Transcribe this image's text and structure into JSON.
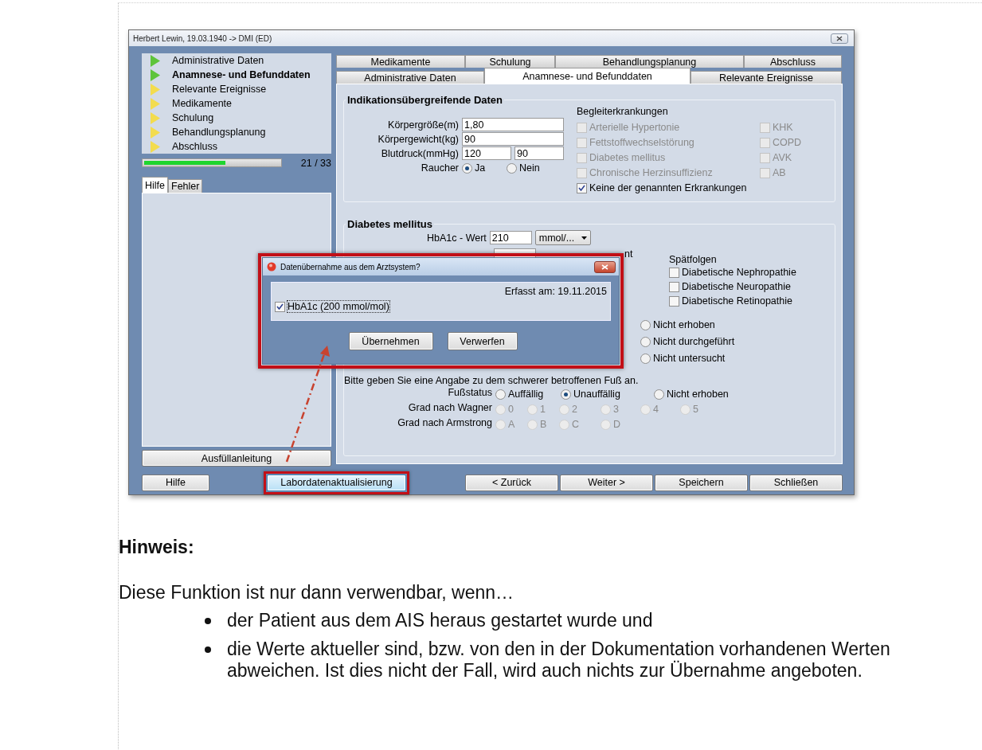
{
  "window": {
    "title": "Herbert Lewin, 19.03.1940 -> DMI (ED)"
  },
  "nav": {
    "items": [
      {
        "label": "Administrative Daten",
        "color": "#5ec43a",
        "selected": false
      },
      {
        "label": "Anamnese- und Befunddaten",
        "color": "#5ec43a",
        "selected": true
      },
      {
        "label": "Relevante Ereignisse",
        "color": "#f3dc4e",
        "selected": false
      },
      {
        "label": "Medikamente",
        "color": "#f3dc4e",
        "selected": false
      },
      {
        "label": "Schulung",
        "color": "#f3dc4e",
        "selected": false
      },
      {
        "label": "Behandlungsplanung",
        "color": "#f3dc4e",
        "selected": false
      },
      {
        "label": "Abschluss",
        "color": "#f3dc4e",
        "selected": false
      }
    ]
  },
  "progress": {
    "level": 0.6,
    "reading": "21 / 33"
  },
  "help_tabs": [
    {
      "label": "Hilfe",
      "selected": true
    },
    {
      "label": "Fehler",
      "selected": false
    }
  ],
  "guide_button": "Ausfüllanleitung",
  "tab_rows": [
    [
      {
        "label": "Medikamente",
        "selected": false
      },
      {
        "label": "Schulung",
        "selected": false
      },
      {
        "label": "Behandlungsplanung",
        "selected": false
      },
      {
        "label": "Abschluss",
        "selected": false
      }
    ],
    [
      {
        "label": "Administrative Daten",
        "selected": false
      },
      {
        "label": "Anamnese- und Befunddaten",
        "selected": true
      },
      {
        "label": "Relevante Ereignisse",
        "selected": false
      }
    ]
  ],
  "general": {
    "title": "Indikationsübergreifende Daten",
    "fields": [
      {
        "label": "Körpergröße(m)",
        "values": [
          "1,80"
        ]
      },
      {
        "label": "Körpergewicht(kg)",
        "values": [
          "90"
        ]
      },
      {
        "label": "Blutdruck(mmHg)",
        "values": [
          "120",
          "90"
        ]
      }
    ],
    "smoker": {
      "label": "Raucher",
      "options": [
        {
          "label": "Ja",
          "selected": true
        },
        {
          "label": "Nein",
          "selected": false
        }
      ]
    },
    "comorbidities": {
      "title": "Begleiterkrankungen",
      "items": [
        {
          "label": "Arterielle Hypertonie",
          "checked": false,
          "disabled": true
        },
        {
          "label": "KHK",
          "checked": false,
          "disabled": true
        },
        {
          "label": "Fettstoffwechselstörung",
          "checked": false,
          "disabled": true
        },
        {
          "label": "COPD",
          "checked": false,
          "disabled": true
        },
        {
          "label": "Diabetes mellitus",
          "checked": false,
          "disabled": true
        },
        {
          "label": "AVK",
          "checked": false,
          "disabled": true
        },
        {
          "label": "Chronische Herzinsuffizienz",
          "checked": false,
          "disabled": true
        },
        {
          "label": "AB",
          "checked": false,
          "disabled": true
        },
        {
          "label": "Keine der genannten Erkrankungen",
          "checked": true,
          "disabled": false
        }
      ]
    }
  },
  "diabetes": {
    "title": "Diabetes mellitus",
    "hba1c": {
      "label": "HbA1c - Wert",
      "value": "210",
      "unit": "mmol/..."
    },
    "covered_label_tail": "nt",
    "late_effects": {
      "title": "Spätfolgen",
      "items": [
        {
          "label": "Diabetische Nephropathie",
          "checked": false
        },
        {
          "label": "Diabetische Neuropathie",
          "checked": false
        },
        {
          "label": "Diabetische Retinopathie",
          "checked": false
        }
      ]
    },
    "status_options": [
      {
        "label": "Nicht erhoben",
        "selected": false
      },
      {
        "label": "Nicht durchgeführt",
        "selected": false
      },
      {
        "label": "Nicht untersucht",
        "selected": false
      }
    ],
    "foot_prompt": "Bitte geben Sie eine Angabe zu dem schwerer betroffenen Fuß an.",
    "foot_rows": [
      {
        "label": "Fußstatus",
        "disabled": false,
        "options": [
          {
            "label": "Auffällig",
            "selected": false
          },
          {
            "label": "Unauffällig",
            "selected": true
          },
          {
            "label": "Nicht erhoben",
            "selected": false
          }
        ]
      },
      {
        "label": "Grad nach Wagner",
        "disabled": true,
        "options": [
          {
            "label": "0",
            "selected": false
          },
          {
            "label": "1",
            "selected": false
          },
          {
            "label": "2",
            "selected": false
          },
          {
            "label": "3",
            "selected": false
          },
          {
            "label": "4",
            "selected": false
          },
          {
            "label": "5",
            "selected": false
          }
        ]
      },
      {
        "label": "Grad nach Armstrong",
        "disabled": true,
        "options": [
          {
            "label": "A",
            "selected": false
          },
          {
            "label": "B",
            "selected": false
          },
          {
            "label": "C",
            "selected": false
          },
          {
            "label": "D",
            "selected": false
          }
        ]
      }
    ]
  },
  "footer_buttons": [
    {
      "label": "Hilfe",
      "highlighted": false
    },
    {
      "label": "Labordatenaktualisierung",
      "highlighted": true
    }
  ],
  "nav_buttons": [
    "< Zurück",
    "Weiter >",
    "Speichern",
    "Schließen"
  ],
  "dialog": {
    "title": "Datenübernahme aus dem Arztsystem?",
    "date": "Erfasst am: 19.11.2015",
    "item": {
      "label": "HbA1c (200 mmol/mol)",
      "checked": true
    },
    "buttons": [
      "Übernehmen",
      "Verwerfen"
    ]
  },
  "note": {
    "heading": "Hinweis:",
    "intro": "Diese Funktion ist nur dann verwendbar, wenn…",
    "bullets": [
      "der Patient aus dem AIS heraus gestartet wurde und",
      "die Werte aktueller sind, bzw. von den in der Dokumentation vorhandenen Werten abweichen. Ist dies nicht der Fall, wird auch nichts zur Übernahme angeboten."
    ]
  }
}
